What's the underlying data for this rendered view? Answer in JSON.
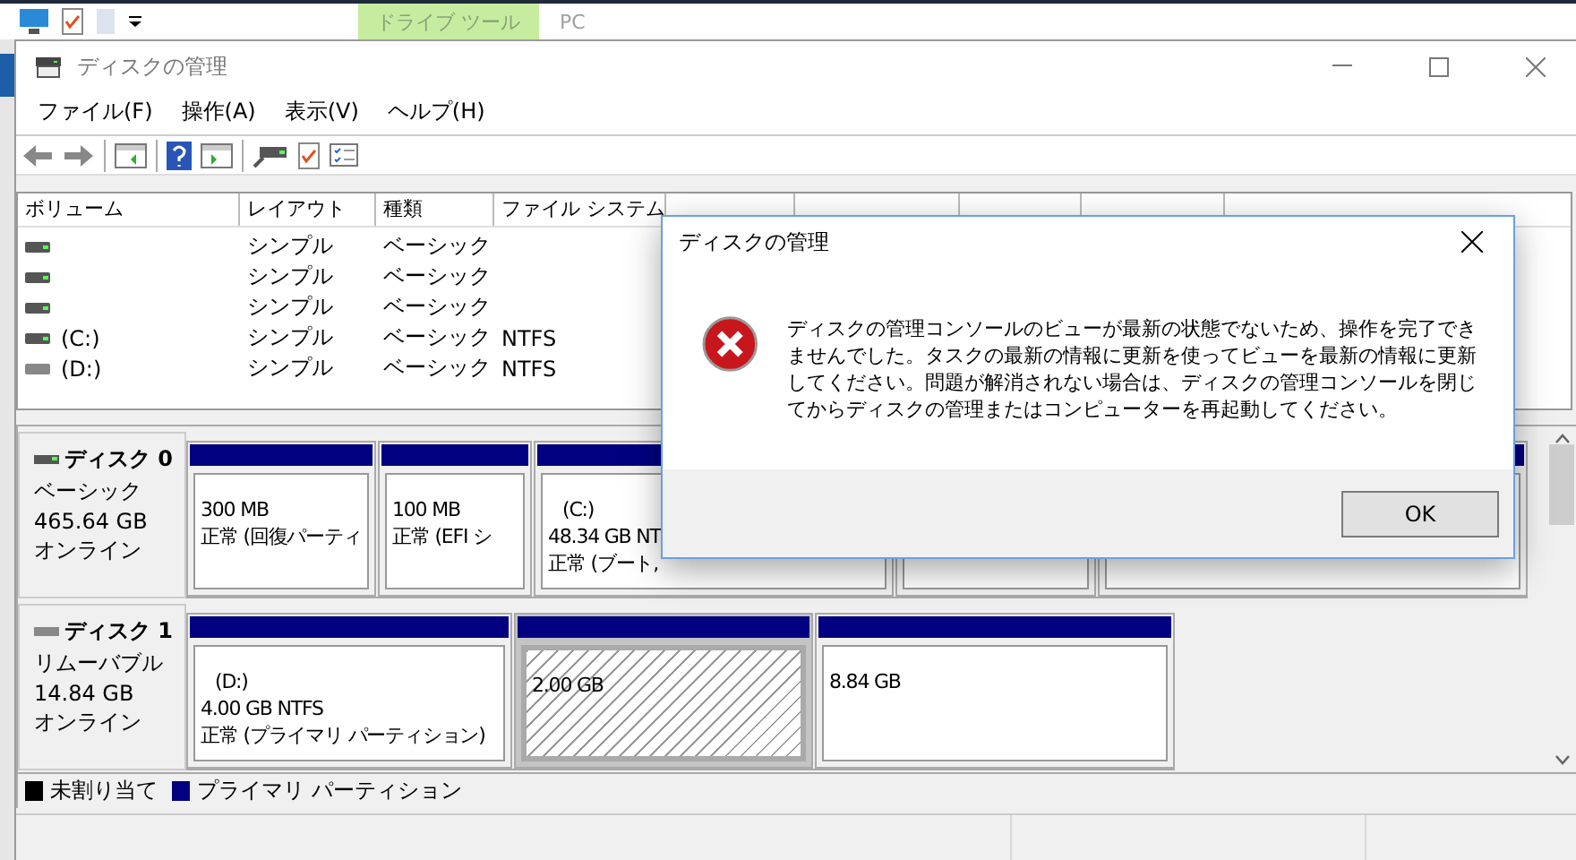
{
  "explorer_bar": {
    "context_tab": "ドライブ ツール",
    "tab": "PC"
  },
  "window": {
    "title": "ディスクの管理"
  },
  "menu": [
    "ファイル(F)",
    "操作(A)",
    "表示(V)",
    "ヘルプ(H)"
  ],
  "volume_table": {
    "columns": [
      "ボリューム",
      "レイアウト",
      "種類",
      "ファイル システム"
    ],
    "rows": [
      {
        "kind": "fixed",
        "layout": "シンプル",
        "type": "ベーシック"
      },
      {
        "kind": "fixed",
        "layout": "シンプル",
        "type": "ベーシック"
      },
      {
        "kind": "fixed",
        "layout": "シンプル",
        "type": "ベーシック"
      },
      {
        "kind": "fixed",
        "volume": "(C:)",
        "layout": "シンプル",
        "type": "ベーシック",
        "file_system": "NTFS"
      },
      {
        "kind": "removable",
        "volume": "(D:)",
        "layout": "シンプル",
        "type": "ベーシック",
        "file_system": "NTFS"
      }
    ]
  },
  "disks": [
    {
      "name": "ディスク 0",
      "kind": "fixed",
      "type": "ベーシック",
      "size": "465.64 GB",
      "status": "オンライン",
      "partitions": [
        {
          "selected": false,
          "lines": [
            "300 MB",
            "正常 (回復パーティ"
          ]
        },
        {
          "selected": false,
          "lines": [
            "100 MB",
            "正常 (EFI シ"
          ]
        },
        {
          "selected": false,
          "lines": [
            "(C:)",
            "48.34 GB NT",
            "正常 (ブート,"
          ]
        },
        {
          "selected": false
        },
        {
          "selected": false
        }
      ]
    },
    {
      "name": "ディスク 1",
      "kind": "removable",
      "type": "リムーバブル",
      "size": "14.84 GB",
      "status": "オンライン",
      "partitions": [
        {
          "selected": false,
          "lines": [
            "(D:)",
            "4.00 GB NTFS",
            "正常 (プライマリ パーティション)"
          ]
        },
        {
          "selected": true,
          "lines": [
            "2.00 GB"
          ]
        },
        {
          "selected": false,
          "lines": [
            "8.84 GB"
          ]
        }
      ]
    }
  ],
  "legend": [
    {
      "label": "未割り当て",
      "color": "#000000"
    },
    {
      "label": "プライマリ パーティション",
      "color": "#000080"
    }
  ],
  "dialog": {
    "title": "ディスクの管理",
    "message": "ディスクの管理コンソールのビューが最新の状態でないため、操作を完了できませんでした。タスクの最新の情報に更新を使ってビューを最新の情報に更新してください。問題が解消されない場合は、ディスクの管理コンソールを閉じてからディスクの管理またはコンピューターを再起動してください。",
    "button": "OK"
  }
}
